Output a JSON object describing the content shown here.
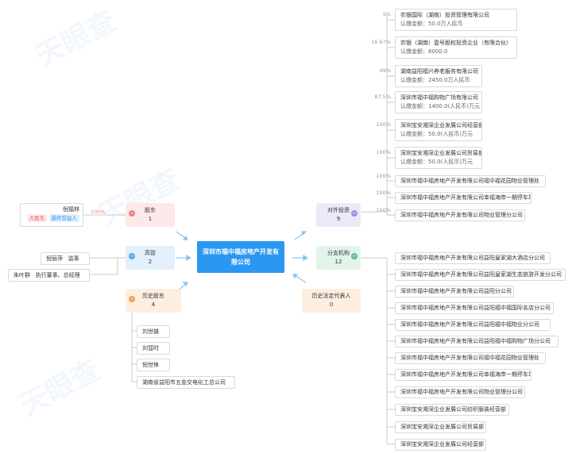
{
  "watermarks": [
    "天眼查",
    "天眼查",
    "天眼查"
  ],
  "center": {
    "name": "深圳市福中福房地产开发有限公司"
  },
  "categories": {
    "shareholders": {
      "label": "股东",
      "count": "1"
    },
    "executives": {
      "label": "高管",
      "count": "2"
    },
    "history_shareholders": {
      "label": "历史股东",
      "count": "4"
    },
    "investments": {
      "label": "对外投资",
      "count": "9"
    },
    "branches": {
      "label": "分支机构",
      "count": "12"
    },
    "history_legal_rep": {
      "label": "历史法定代表人",
      "count": "0"
    }
  },
  "shareholder": {
    "name": "倪福林",
    "tag1": "大股东",
    "tag2": "最终受益人",
    "pct": "100%"
  },
  "executives": [
    {
      "name": "倪丽萍",
      "role": "监事"
    },
    {
      "name": "朱叶群",
      "role": "执行董事、总经理"
    }
  ],
  "history_shareholders": [
    "刘世雄",
    "刘彗时",
    "倪世锋",
    "湖南省益阳市五金交电化工总公司"
  ],
  "investments": [
    {
      "pct": "5%",
      "name": "农银国际（湖南）投资管理有限公司",
      "capital": "认缴金额：50.0万人民币"
    },
    {
      "pct": "16.67%",
      "name": "农银（湖南）壹号股权投资企业（有限合伙）",
      "capital": "认缴金额：8000.0"
    },
    {
      "pct": "49%",
      "name": "湖南益阳福兴养老服务有限公司",
      "capital": "认缴金额：2450.0万人民币"
    },
    {
      "pct": "87.5%",
      "name": "深圳市福中福购物广场有限公司",
      "capital": "认缴金额：1400.0(人民币)万元"
    },
    {
      "pct": "100%",
      "name": "深圳宝安湘深企业发展公司经营部",
      "capital": "认缴金额：50.0(人民币)万元"
    },
    {
      "pct": "100%",
      "name": "深圳宝安湘深企业发展公司贸易部",
      "capital": "认缴金额：50.0(人民币)万元"
    },
    {
      "pct": "100%",
      "name": "深圳市福中福房地产开发有限公司福中福花园物业管理处",
      "capital": ""
    },
    {
      "pct": "100%",
      "name": "深圳市福中福房地产开发有限公司幸福海岸一期停车场",
      "capital": ""
    },
    {
      "pct": "100%",
      "name": "深圳市福中福房地产开发有限公司物业管理分公司",
      "capital": ""
    }
  ],
  "branches": [
    "深圳市福中福房地产开发有限公司益阳皇家湖大酒店分公司",
    "深圳市福中福房地产开发有限公司益阳皇家湖生态旅游开发分公司",
    "深圳市福中福房地产开发有限公司益阳分公司",
    "深圳市福中福房地产开发有限公司益阳福中福国际名店分公司",
    "深圳市福中福房地产开发有限公司益阳福中福物业分公司",
    "深圳市福中福房地产开发有限公司益阳福中福购物广场分公司",
    "深圳市福中福房地产开发有限公司福中福花园物业管理处",
    "深圳市福中福房地产开发有限公司幸福海岸一期停车场",
    "深圳市福中福房地产开发有限公司物业管理分公司",
    "深圳宝安湘深企业发展公司纺织服装经营部",
    "深圳宝安湘深企业发展公司贸易部",
    "深圳宝安湘深企业发展公司经营部"
  ],
  "colors": {
    "center": "#2a97f0",
    "shareholder_bg": "#fde9e9",
    "shareholder_minus": "#f08080",
    "executive_bg": "#e3f0fb",
    "executive_minus": "#5aa9e6",
    "history_bg": "#fdeee0",
    "history_minus": "#f0a060",
    "investment_bg": "#ece9f8",
    "investment_minus": "#9d8fe0",
    "branch_bg": "#e2f3ea",
    "branch_minus": "#5bbf8a",
    "legal_bg": "#fdeee0",
    "tag_red": "#f05a5a",
    "tag_blue": "#2a97f0"
  }
}
